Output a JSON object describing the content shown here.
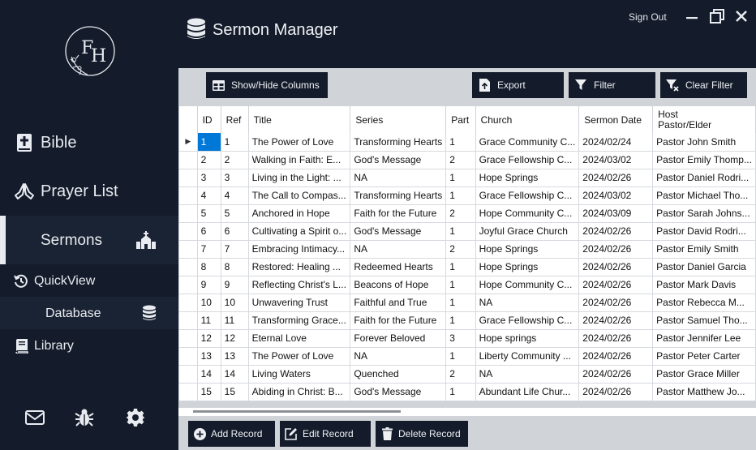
{
  "app": {
    "title": "Sermon Manager",
    "sign_out": "Sign Out"
  },
  "logo": {
    "letters": "FH"
  },
  "sidebar": {
    "bible": "Bible",
    "prayer_list": "Prayer List",
    "sermons": "Sermons",
    "quickview": "QuickView",
    "database": "Database",
    "library": "Library"
  },
  "toolbar": {
    "show_hide": "Show/Hide Columns",
    "export": "Export",
    "filter": "Filter",
    "clear_filter": "Clear Filter"
  },
  "table": {
    "columns": [
      "ID",
      "Ref",
      "Title",
      "Series",
      "Part",
      "Church",
      "Sermon Date",
      "Host\nPastor/Elder"
    ],
    "rows": [
      [
        "1",
        "1",
        "The Power of Love",
        "Transforming Hearts",
        "1",
        "Grace Community C...",
        "2024/02/24",
        "Pastor John Smith"
      ],
      [
        "2",
        "2",
        "Walking in Faith: E...",
        "God's Message",
        "2",
        "Grace Fellowship C...",
        "2024/03/02",
        "Pastor Emily Thomp..."
      ],
      [
        "3",
        "3",
        "Living in the Light: ...",
        "NA",
        "1",
        "Hope Springs",
        "2024/02/26",
        "Pastor Daniel Rodri..."
      ],
      [
        "4",
        "4",
        "The Call to Compas...",
        "Transforming Hearts",
        "1",
        "Grace Fellowship C...",
        "2024/03/02",
        "Pastor Michael Tho..."
      ],
      [
        "5",
        "5",
        "Anchored in Hope",
        "Faith for the Future",
        "2",
        "Hope Community C...",
        "2024/03/09",
        "Pastor Sarah Johns..."
      ],
      [
        "6",
        "6",
        "Cultivating a Spirit o...",
        "God's Message",
        "1",
        "Joyful Grace Church",
        "2024/02/26",
        "Pastor David Rodri..."
      ],
      [
        "7",
        "7",
        "Embracing Intimacy...",
        "NA",
        "2",
        "Hope Springs",
        "2024/02/26",
        "Pastor Emily Smith"
      ],
      [
        "8",
        "8",
        "Restored: Healing ...",
        "Redeemed Hearts",
        "1",
        "Hope Springs",
        "2024/02/26",
        "Pastor Daniel Garcia"
      ],
      [
        "9",
        "9",
        "Reflecting Christ's L...",
        "Beacons of Hope",
        "1",
        "Hope Community C...",
        "2024/02/26",
        "Pastor Mark Davis"
      ],
      [
        "10",
        "10",
        "Unwavering Trust",
        "Faithful and True",
        "1",
        "NA",
        "2024/02/26",
        "Pastor Rebecca M..."
      ],
      [
        "11",
        "11",
        "Transforming Grace...",
        "Faith for the Future",
        "1",
        "Grace Fellowship C...",
        "2024/02/26",
        "Pastor Samuel Tho..."
      ],
      [
        "12",
        "12",
        "Eternal Love",
        "Forever Beloved",
        "3",
        "Hope springs",
        "2024/02/26",
        "Pastor Jennifer Lee"
      ],
      [
        "13",
        "13",
        "The Power of Love",
        "NA",
        "1",
        "Liberty Community ...",
        "2024/02/26",
        "Pastor Peter Carter"
      ],
      [
        "14",
        "14",
        "Living Waters",
        "Quenched",
        "2",
        "NA",
        "2024/02/26",
        "Pastor Grace Miller"
      ],
      [
        "15",
        "15",
        "Abiding in Christ: B...",
        "God's Message",
        "1",
        "Abundant Life Chur...",
        "2024/02/26",
        "Pastor Matthew Jo..."
      ]
    ]
  },
  "actions": {
    "add": "Add Record",
    "edit": "Edit Record",
    "delete": "Delete Record"
  },
  "colors": {
    "sidebar_bg": "#141c2b",
    "content_bg": "#d0d3d8",
    "selection": "#0078d7"
  }
}
